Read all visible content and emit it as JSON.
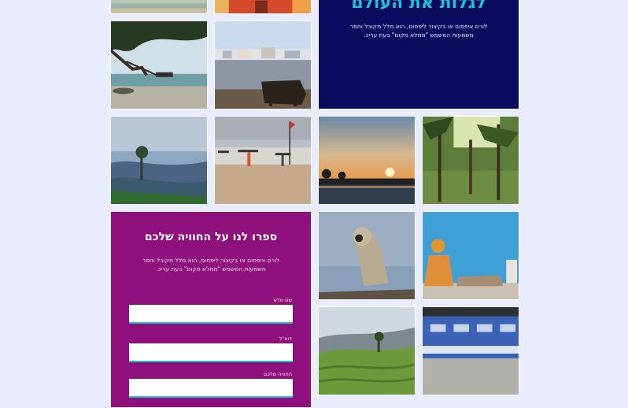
{
  "hero": {
    "title": "לגלות את העולם",
    "description": "לורם איפסום או בקיצור ליפסום, הוא מלל מקובל וחסר משמעות המשמש \"ממלא מקום\" בעת עריכ."
  },
  "form": {
    "title": "ספרו לנו על החוויה שלכם",
    "description": "לורם איפסום או בקיצור ליפסום, הוא מלל מקובל וחסר משמעות המשמש \"ממלא מקום\" בעת עריכ.",
    "fields": [
      {
        "label": "שם מלא",
        "value": ""
      },
      {
        "label": "דוא\"ל",
        "value": ""
      },
      {
        "label": "החוויה שלכם",
        "value": ""
      }
    ]
  },
  "gallery": {
    "photos": [
      "beach-photo",
      "monks-photo",
      "swing-tree-beach-photo",
      "cow-lakeside-town-photo",
      "misty-hills-photo",
      "beach-people-flag-photo",
      "sunset-lake-photo",
      "palm-forest-photo",
      "langur-monkey-photo",
      "sadhu-blue-wall-photo",
      "tea-plantation-photo",
      "train-motion-photo"
    ]
  }
}
